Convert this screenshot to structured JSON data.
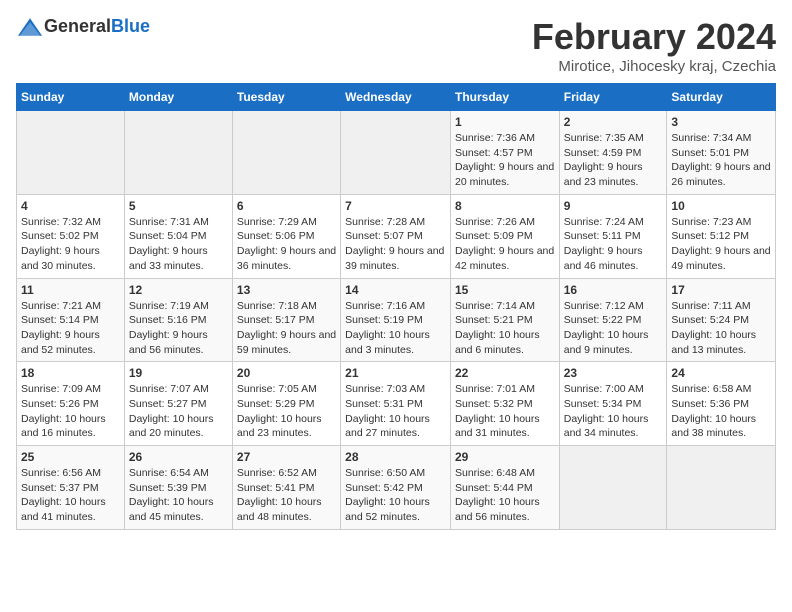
{
  "logo": {
    "text_general": "General",
    "text_blue": "Blue"
  },
  "header": {
    "month_title": "February 2024",
    "location": "Mirotice, Jihocesky kraj, Czechia"
  },
  "days_of_week": [
    "Sunday",
    "Monday",
    "Tuesday",
    "Wednesday",
    "Thursday",
    "Friday",
    "Saturday"
  ],
  "weeks": [
    [
      {
        "day": "",
        "info": ""
      },
      {
        "day": "",
        "info": ""
      },
      {
        "day": "",
        "info": ""
      },
      {
        "day": "",
        "info": ""
      },
      {
        "day": "1",
        "info": "Sunrise: 7:36 AM\nSunset: 4:57 PM\nDaylight: 9 hours and 20 minutes."
      },
      {
        "day": "2",
        "info": "Sunrise: 7:35 AM\nSunset: 4:59 PM\nDaylight: 9 hours and 23 minutes."
      },
      {
        "day": "3",
        "info": "Sunrise: 7:34 AM\nSunset: 5:01 PM\nDaylight: 9 hours and 26 minutes."
      }
    ],
    [
      {
        "day": "4",
        "info": "Sunrise: 7:32 AM\nSunset: 5:02 PM\nDaylight: 9 hours and 30 minutes."
      },
      {
        "day": "5",
        "info": "Sunrise: 7:31 AM\nSunset: 5:04 PM\nDaylight: 9 hours and 33 minutes."
      },
      {
        "day": "6",
        "info": "Sunrise: 7:29 AM\nSunset: 5:06 PM\nDaylight: 9 hours and 36 minutes."
      },
      {
        "day": "7",
        "info": "Sunrise: 7:28 AM\nSunset: 5:07 PM\nDaylight: 9 hours and 39 minutes."
      },
      {
        "day": "8",
        "info": "Sunrise: 7:26 AM\nSunset: 5:09 PM\nDaylight: 9 hours and 42 minutes."
      },
      {
        "day": "9",
        "info": "Sunrise: 7:24 AM\nSunset: 5:11 PM\nDaylight: 9 hours and 46 minutes."
      },
      {
        "day": "10",
        "info": "Sunrise: 7:23 AM\nSunset: 5:12 PM\nDaylight: 9 hours and 49 minutes."
      }
    ],
    [
      {
        "day": "11",
        "info": "Sunrise: 7:21 AM\nSunset: 5:14 PM\nDaylight: 9 hours and 52 minutes."
      },
      {
        "day": "12",
        "info": "Sunrise: 7:19 AM\nSunset: 5:16 PM\nDaylight: 9 hours and 56 minutes."
      },
      {
        "day": "13",
        "info": "Sunrise: 7:18 AM\nSunset: 5:17 PM\nDaylight: 9 hours and 59 minutes."
      },
      {
        "day": "14",
        "info": "Sunrise: 7:16 AM\nSunset: 5:19 PM\nDaylight: 10 hours and 3 minutes."
      },
      {
        "day": "15",
        "info": "Sunrise: 7:14 AM\nSunset: 5:21 PM\nDaylight: 10 hours and 6 minutes."
      },
      {
        "day": "16",
        "info": "Sunrise: 7:12 AM\nSunset: 5:22 PM\nDaylight: 10 hours and 9 minutes."
      },
      {
        "day": "17",
        "info": "Sunrise: 7:11 AM\nSunset: 5:24 PM\nDaylight: 10 hours and 13 minutes."
      }
    ],
    [
      {
        "day": "18",
        "info": "Sunrise: 7:09 AM\nSunset: 5:26 PM\nDaylight: 10 hours and 16 minutes."
      },
      {
        "day": "19",
        "info": "Sunrise: 7:07 AM\nSunset: 5:27 PM\nDaylight: 10 hours and 20 minutes."
      },
      {
        "day": "20",
        "info": "Sunrise: 7:05 AM\nSunset: 5:29 PM\nDaylight: 10 hours and 23 minutes."
      },
      {
        "day": "21",
        "info": "Sunrise: 7:03 AM\nSunset: 5:31 PM\nDaylight: 10 hours and 27 minutes."
      },
      {
        "day": "22",
        "info": "Sunrise: 7:01 AM\nSunset: 5:32 PM\nDaylight: 10 hours and 31 minutes."
      },
      {
        "day": "23",
        "info": "Sunrise: 7:00 AM\nSunset: 5:34 PM\nDaylight: 10 hours and 34 minutes."
      },
      {
        "day": "24",
        "info": "Sunrise: 6:58 AM\nSunset: 5:36 PM\nDaylight: 10 hours and 38 minutes."
      }
    ],
    [
      {
        "day": "25",
        "info": "Sunrise: 6:56 AM\nSunset: 5:37 PM\nDaylight: 10 hours and 41 minutes."
      },
      {
        "day": "26",
        "info": "Sunrise: 6:54 AM\nSunset: 5:39 PM\nDaylight: 10 hours and 45 minutes."
      },
      {
        "day": "27",
        "info": "Sunrise: 6:52 AM\nSunset: 5:41 PM\nDaylight: 10 hours and 48 minutes."
      },
      {
        "day": "28",
        "info": "Sunrise: 6:50 AM\nSunset: 5:42 PM\nDaylight: 10 hours and 52 minutes."
      },
      {
        "day": "29",
        "info": "Sunrise: 6:48 AM\nSunset: 5:44 PM\nDaylight: 10 hours and 56 minutes."
      },
      {
        "day": "",
        "info": ""
      },
      {
        "day": "",
        "info": ""
      }
    ]
  ]
}
